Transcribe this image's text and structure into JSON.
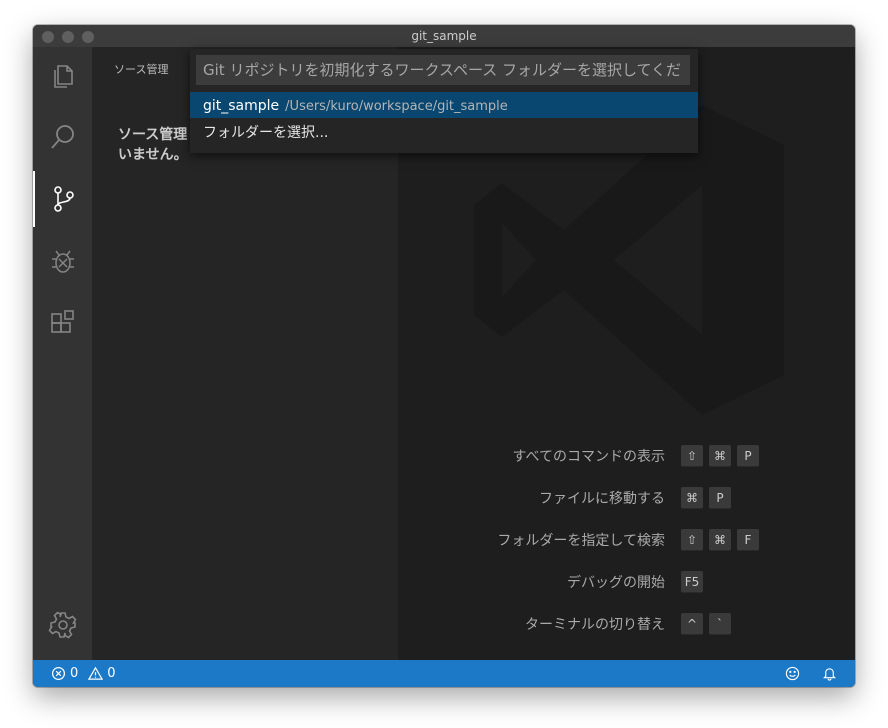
{
  "window": {
    "title": "git_sample"
  },
  "sidebar": {
    "title": "ソース管理",
    "message_line1": "ソース管理",
    "message_line2": "いません。"
  },
  "quick_pick": {
    "placeholder": "Git リポジトリを初期化するワークスペース フォルダーを選択してください",
    "items": [
      {
        "label": "git_sample",
        "description": "/Users/kuro/workspace/git_sample"
      },
      {
        "label": "フォルダーを選択..."
      }
    ]
  },
  "shortcuts": [
    {
      "label": "すべてのコマンドの表示",
      "keys": [
        "⇧",
        "⌘",
        "P"
      ]
    },
    {
      "label": "ファイルに移動する",
      "keys": [
        "⌘",
        "P"
      ]
    },
    {
      "label": "フォルダーを指定して検索",
      "keys": [
        "⇧",
        "⌘",
        "F"
      ]
    },
    {
      "label": "デバッグの開始",
      "keys": [
        "F5"
      ]
    },
    {
      "label": "ターミナルの切り替え",
      "keys": [
        "^",
        "`"
      ]
    }
  ],
  "status": {
    "errors": "0",
    "warnings": "0"
  },
  "icons": {
    "activity": [
      "files-icon",
      "search-icon",
      "source-control-icon",
      "debug-icon",
      "extensions-icon",
      "gear-icon"
    ],
    "status": [
      "error-icon",
      "warning-icon",
      "smiley-icon",
      "bell-icon"
    ]
  },
  "colors": {
    "accent": "#1c79c8",
    "selection": "#094771"
  }
}
